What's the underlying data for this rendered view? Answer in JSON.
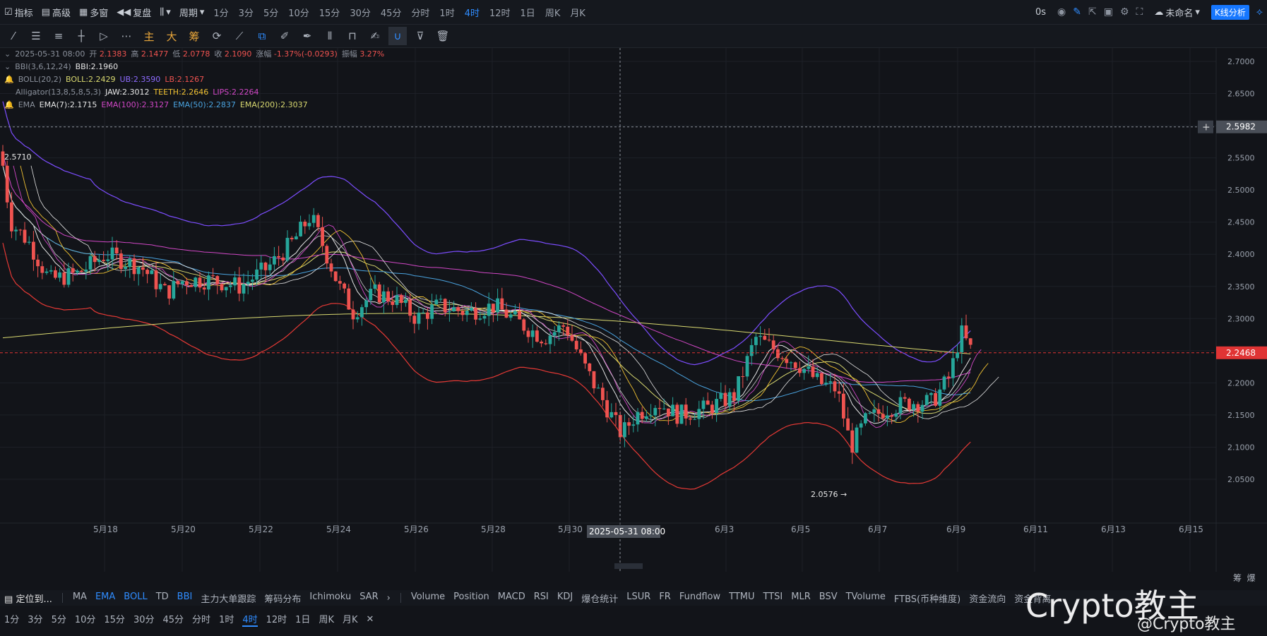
{
  "toolbar": {
    "items": [
      "指标",
      "高级",
      "多窗",
      "复盘",
      "周期"
    ],
    "timeframes": [
      "1分",
      "3分",
      "5分",
      "10分",
      "15分",
      "30分",
      "45分",
      "分时",
      "1时",
      "4时",
      "12时",
      "1日",
      "周K",
      "月K"
    ],
    "active_timeframe": "4时",
    "right": {
      "delay": "0s",
      "layout_name": "未命名",
      "analysis_button": "K线分析"
    }
  },
  "drawing_tools": {
    "labels": [
      "主",
      "大",
      "筹"
    ]
  },
  "legend": {
    "ohlc": {
      "date": "2025-05-31 08:00",
      "open_label": "开",
      "open": "2.1383",
      "high_label": "高",
      "high": "2.1477",
      "low_label": "低",
      "low": "2.0778",
      "close_label": "收",
      "close": "2.1090",
      "chg_label": "涨幅",
      "chg": "-1.37%(-0.0293)",
      "amp_label": "振幅",
      "amp": "3.27%"
    },
    "bbi": {
      "name": "BBI(3,6,12,24)",
      "value": "BBI:2.1960"
    },
    "boll": {
      "name": "BOLL(20,2)",
      "mid": "BOLL:2.2429",
      "ub": "UB:2.3590",
      "lb": "LB:2.1267"
    },
    "alligator": {
      "name": "Alligator(13,8,5,8,5,3)",
      "jaw": "JAW:2.3012",
      "teeth": "TEETH:2.2646",
      "lips": "LIPS:2.2264"
    },
    "ema": {
      "name": "EMA",
      "e7": "EMA(7):2.1715",
      "e100": "EMA(100):2.3127",
      "e50": "EMA(50):2.2837",
      "e200": "EMA(200):2.3037"
    }
  },
  "chart_data": {
    "type": "candlestick",
    "y_ticks": [
      "2.7000",
      "2.6500",
      "2.6000",
      "2.5500",
      "2.5000",
      "2.4500",
      "2.4000",
      "2.3500",
      "2.3000",
      "2.2500",
      "2.2000",
      "2.1500",
      "2.1000",
      "2.0500"
    ],
    "ylim": [
      2.05,
      2.7
    ],
    "x_ticks": [
      "5月18",
      "5月20",
      "5月22",
      "5月24",
      "5月26",
      "5月28",
      "5月30",
      "6月3",
      "6月5",
      "6月7",
      "6月9",
      "6月11",
      "6月13",
      "6月15"
    ],
    "crosshair_price": "2.5982",
    "crosshair_time": "2025-05-31 08:00",
    "last_price": "2.2468",
    "annotations": {
      "high": "2.5710",
      "low": "2.0576"
    },
    "colors": {
      "up": "#26a69a",
      "down": "#ef5350",
      "boll_ub": "#7c4dff",
      "boll_lb": "#e53935",
      "last_price": "#e03434"
    }
  },
  "indicators_bar": {
    "locate": "定位到...",
    "main": [
      "MA",
      "EMA",
      "BOLL",
      "TD",
      "BBI",
      "主力大单跟踪",
      "筹码分布",
      "Ichimoku",
      "SAR"
    ],
    "main_on": [
      "EMA",
      "BOLL",
      "BBI"
    ],
    "sub": [
      "Volume",
      "Position",
      "MACD",
      "RSI",
      "KDJ",
      "爆仓统计",
      "LSUR",
      "FR",
      "Fundflow",
      "TTMU",
      "TTSI",
      "MLR",
      "BSV",
      "TVolume",
      "FTBS(币种维度)",
      "资金流向",
      "资金背离"
    ]
  },
  "timeframe_bar": {
    "items": [
      "1分",
      "3分",
      "5分",
      "10分",
      "15分",
      "30分",
      "45分",
      "分时",
      "1时",
      "4时",
      "12时",
      "1日",
      "周K",
      "月K"
    ],
    "active": "4时"
  },
  "right_corner": {
    "labels": [
      "筹",
      "爆"
    ]
  },
  "watermark": {
    "main": "Crypto教主",
    "sub": "@Crypto教主"
  }
}
